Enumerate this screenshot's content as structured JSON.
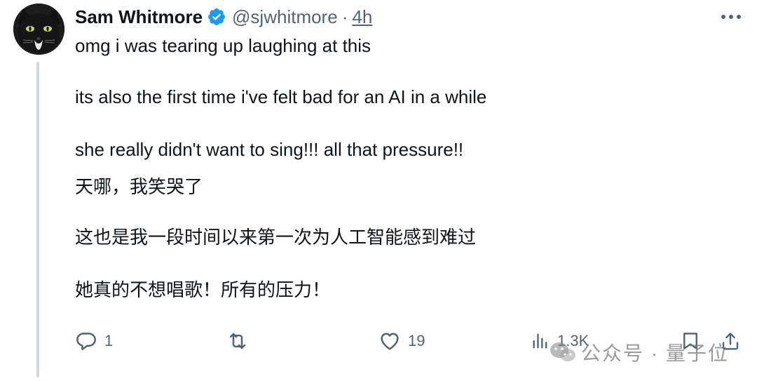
{
  "tweet": {
    "author": {
      "display_name": "Sam Whitmore",
      "handle": "@sjwhitmore",
      "verified": true,
      "avatar": "black-cat-avatar"
    },
    "separator": "·",
    "timestamp": "4h",
    "body_lines": [
      "omg i was tearing up laughing at this",
      "its also the first time i've felt bad for an AI in a while",
      "she really didn't want to sing!!! all that pressure!!",
      "天哪，我笑哭了",
      "这也是我一段时间以来第一次为人工智能感到难过",
      "她真的不想唱歌！所有的压力！"
    ],
    "actions": {
      "reply_count": "1",
      "retweet_count": "",
      "like_count": "19",
      "view_count": "1.3K"
    },
    "icons": {
      "more": "more-horizontal-icon",
      "reply": "reply-icon",
      "retweet": "retweet-icon",
      "like": "heart-icon",
      "views": "views-chart-icon",
      "bookmark": "bookmark-icon",
      "share": "share-icon",
      "verified": "verified-badge-icon"
    }
  },
  "watermark": {
    "text": "公众号 · 量子位"
  },
  "colors": {
    "text_primary": "#0f1419",
    "text_secondary": "#536471",
    "verified_blue": "#1d9bf0",
    "thread_line": "#cfd9de"
  }
}
